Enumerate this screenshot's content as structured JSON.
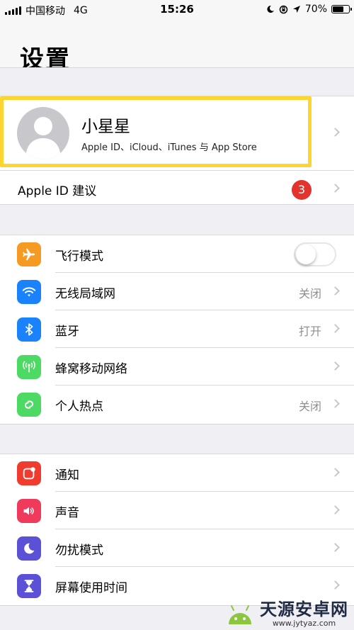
{
  "status_bar": {
    "carrier": "中国移动",
    "network": "4G",
    "time": "15:26",
    "battery": "70%",
    "battery_level": 0.7
  },
  "nav": {
    "title": "设置"
  },
  "profile": {
    "name": "小星星",
    "subtitle": "Apple ID、iCloud、iTunes 与 App Store"
  },
  "suggestions": {
    "label": "Apple ID 建议",
    "badge": "3"
  },
  "group1": [
    {
      "label": "飞行模式",
      "icon": "airplane-icon",
      "color": "#f59a23",
      "toggle": true,
      "toggle_on": false
    },
    {
      "label": "无线局域网",
      "icon": "wifi-icon",
      "color": "#1a82fb",
      "value": "关闭"
    },
    {
      "label": "蓝牙",
      "icon": "bluetooth-icon",
      "color": "#1a82fb",
      "value": "打开"
    },
    {
      "label": "蜂窝移动网络",
      "icon": "cellular-icon",
      "color": "#4cd964",
      "value": ""
    },
    {
      "label": "个人热点",
      "icon": "hotspot-icon",
      "color": "#4cd964",
      "value": "关闭"
    }
  ],
  "group2": [
    {
      "label": "通知",
      "icon": "notifications-icon",
      "color": "#f03b2f"
    },
    {
      "label": "声音",
      "icon": "sound-icon",
      "color": "#f03a5c"
    },
    {
      "label": "勿扰模式",
      "icon": "moon-icon",
      "color": "#5b50d6"
    },
    {
      "label": "屏幕使用时间",
      "icon": "hourglass-icon",
      "color": "#5b50d6"
    }
  ],
  "watermark": {
    "name": "天源安卓网",
    "url": "www.jytyaz.com"
  }
}
